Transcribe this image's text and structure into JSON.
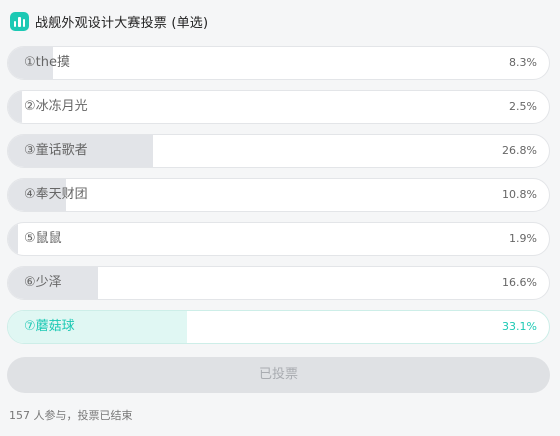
{
  "header": {
    "icon": "bar-chart-icon",
    "title": "战舰外观设计大赛投票 (单选)"
  },
  "options": [
    {
      "label": "①the摸",
      "percent": "8.3%",
      "value": 8.3,
      "selected": false
    },
    {
      "label": "②冰冻月光",
      "percent": "2.5%",
      "value": 2.5,
      "selected": false
    },
    {
      "label": "③童话歌者",
      "percent": "26.8%",
      "value": 26.8,
      "selected": false
    },
    {
      "label": "④奉天财团",
      "percent": "10.8%",
      "value": 10.8,
      "selected": false
    },
    {
      "label": "⑤鼠鼠",
      "percent": "1.9%",
      "value": 1.9,
      "selected": false
    },
    {
      "label": "⑥少泽",
      "percent": "16.6%",
      "value": 16.6,
      "selected": false
    },
    {
      "label": "⑦蘑菇球",
      "percent": "33.1%",
      "value": 33.1,
      "selected": true
    }
  ],
  "vote_button": {
    "label": "已投票"
  },
  "footer": {
    "text": "157 人参与，投票已结束"
  },
  "colors": {
    "accent": "#1cc9b4",
    "fill": "#e2e4e8",
    "selected_fill": "#e0f7f3"
  }
}
